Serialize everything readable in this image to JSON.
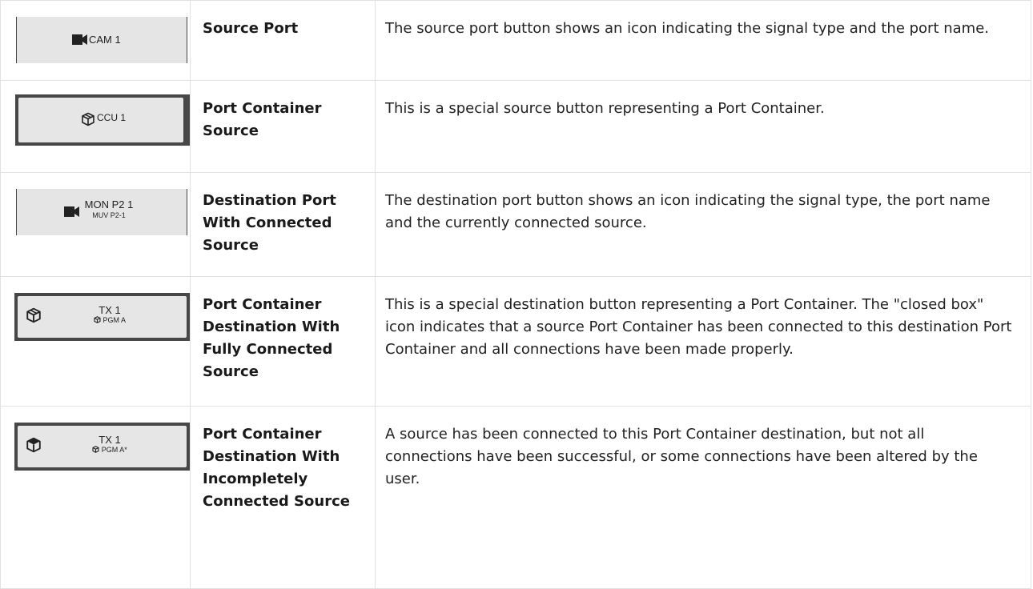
{
  "rows": [
    {
      "button": {
        "label": "CAM 1",
        "icon": "camera-icon"
      },
      "term": "Source Port",
      "description": "The source port button shows an icon indicating the signal type and the port name."
    },
    {
      "button": {
        "label": "CCU 1",
        "icon": "open-box-icon"
      },
      "term": "Port Container Source",
      "description": "This is a special source button representing a Port Container."
    },
    {
      "button": {
        "label": "MON P2 1",
        "sublabel": "MUV P2-1",
        "icon": "camera-icon"
      },
      "term": "Destination Port With Connected Source",
      "description": "The destination port button shows an icon indicating the signal type, the port name and the currently connected source."
    },
    {
      "button": {
        "label": "TX 1",
        "sublabel": "PGM A",
        "icon": "closed-box-icon",
        "subicon": "box-icon"
      },
      "term": "Port Container Destination With Fully Connected Source",
      "description": "This is a special destination button representing a Port Container. The \"closed box\" icon indicates that a source Port Container has been connected to this destination Port Container and all connections have been made properly."
    },
    {
      "button": {
        "label": "TX 1",
        "sublabel": "PGM A*",
        "icon": "partial-box-icon",
        "subicon": "box-icon"
      },
      "term": "Port Container Destination With Incompletely Connected Source",
      "description": "A source has been connected to this Port Container destination, but not all connections have been successful, or some connections have been altered by the user."
    }
  ]
}
